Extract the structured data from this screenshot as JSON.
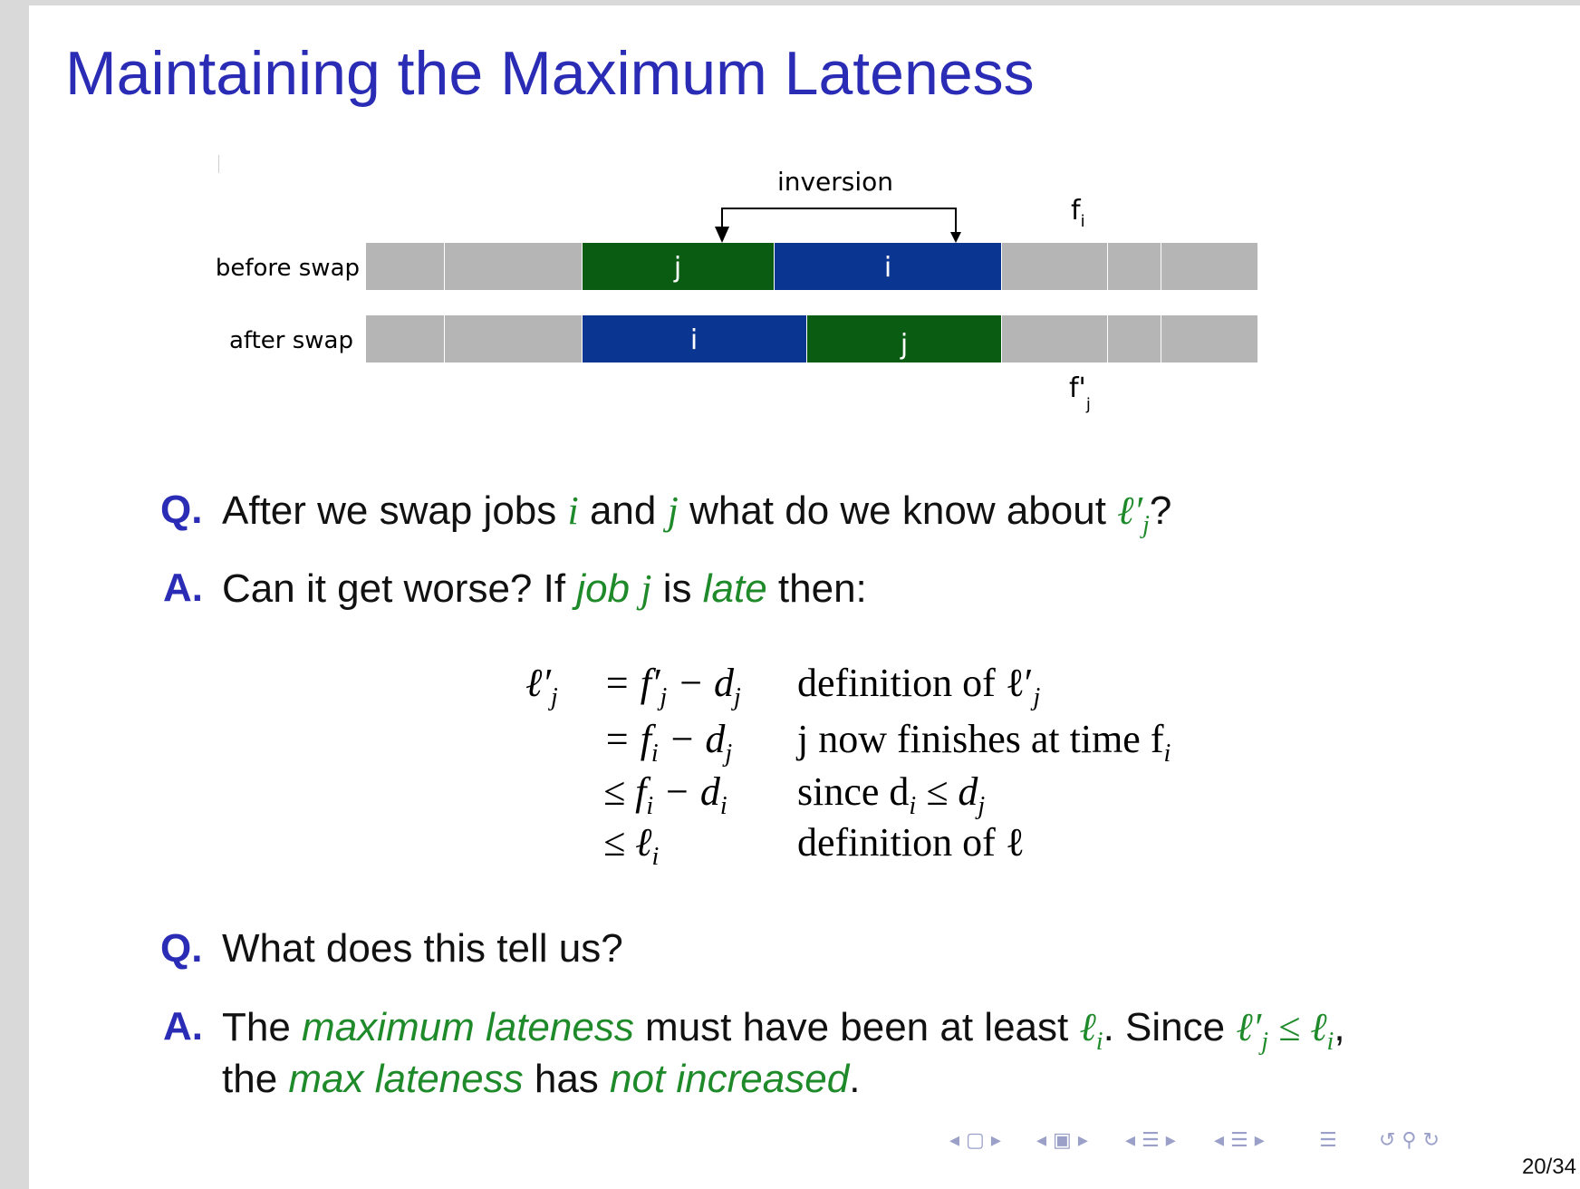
{
  "slide": {
    "title": "Maintaining the Maximum Lateness",
    "page_number": "20/34"
  },
  "diagram": {
    "inversion_label": "inversion",
    "before_label": "before swap",
    "after_label": "after swap",
    "fi_label": "f",
    "fi_sub": "i",
    "fj_label": "f'",
    "fj_sub": "j",
    "job_i": "i",
    "job_j": "j",
    "colors": {
      "gray": "#b5b5b5",
      "green": "#0b5c13",
      "blue": "#0a3591"
    }
  },
  "q1": {
    "marker": "Q.",
    "t1": "After we swap jobs ",
    "v_i": "i",
    "t2": " and ",
    "v_j": "j",
    "t3": " what do we know about ",
    "v_l": "ℓ′",
    "v_l_sub": "j",
    "t4": "?"
  },
  "a1": {
    "marker": "A.",
    "t1": "Can it get worse? If ",
    "g1": "job",
    "g1v": "j",
    "t2": " is ",
    "g2": "late",
    "t3": " then:"
  },
  "derivation": {
    "lhs": "ℓ′",
    "lhs_sub": "j",
    "rows": [
      {
        "rel": "= f′",
        "rel_sub": "j",
        "rest": " − d",
        "rest_sub": "j",
        "reason": "definition of ℓ′",
        "reason_sub": "j"
      },
      {
        "rel": "= f",
        "rel_sub": "i",
        "rest": " − d",
        "rest_sub": "j",
        "reason": "j now finishes at time f",
        "reason_sub": "i"
      },
      {
        "rel": "≤ f",
        "rel_sub": "i",
        "rest": " − d",
        "rest_sub": "i",
        "reason": "since d",
        "reason_sub": "i",
        "reason_tail": " ≤ d",
        "reason_tail_sub": "j"
      },
      {
        "rel": "≤ ℓ",
        "rel_sub": "i",
        "rest": "",
        "rest_sub": "",
        "reason": "definition of ℓ",
        "reason_sub": ""
      }
    ]
  },
  "q2": {
    "marker": "Q.",
    "text": "What does this tell us?"
  },
  "a2": {
    "marker": "A.",
    "t1": "The ",
    "g1": "maximum lateness",
    "t2": " must have been at least ",
    "g2": "ℓ",
    "g2_sub": "i",
    "t3": ". Since ",
    "g3": "ℓ′",
    "g3_sub": "j",
    "g3b": " ≤ ℓ",
    "g3b_sub": "i",
    "t4": ",",
    "l2a": "the ",
    "g4": "max lateness",
    "l2b": " has ",
    "g5": "not increased",
    "l2c": "."
  },
  "nav_icons": [
    "nav-first-icon",
    "nav-frame-icon",
    "nav-section-icon",
    "nav-subsection-icon",
    "nav-outline-icon",
    "nav-search-icon"
  ]
}
